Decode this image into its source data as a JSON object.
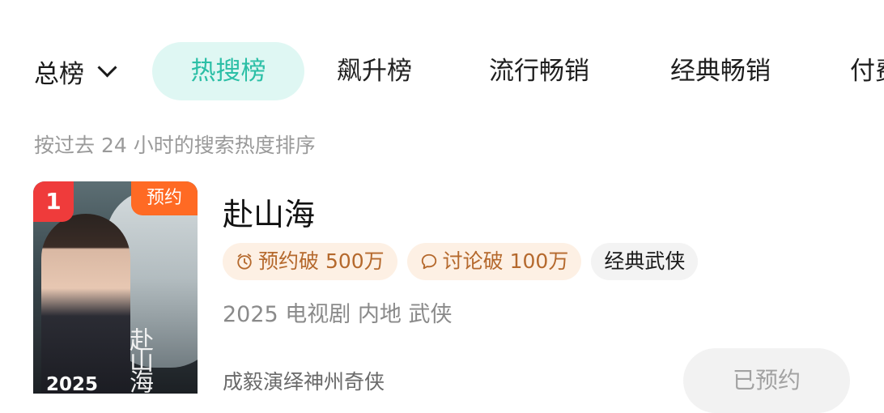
{
  "tabs": {
    "total_label": "总榜",
    "items": [
      {
        "label": "热搜榜"
      },
      {
        "label": "飙升榜"
      },
      {
        "label": "流行畅销"
      },
      {
        "label": "经典畅销"
      },
      {
        "label": "付费"
      }
    ],
    "active_color": "#2bbfa6",
    "active_bg": "#dff7f3"
  },
  "subtitle": "按过去 24 小时的搜索热度排序",
  "item": {
    "rank": "1",
    "badge": "预约",
    "poster_year": "2025",
    "poster_calligraphy": "赴山海",
    "title": "赴山海",
    "tags": [
      {
        "icon": "clock-icon",
        "text": "预约破 500万"
      },
      {
        "icon": "chat-bubble-icon",
        "text": "讨论破 100万"
      },
      {
        "text": "经典武侠"
      }
    ],
    "meta": "2025 电视剧 内地 武侠",
    "description": "成毅演绎神州奇侠",
    "reserve_button": "已预约"
  },
  "colors": {
    "rank_bg": "#ef3b3b",
    "badge_bg": "#ff6a24",
    "tag_warm_text": "#b5692d",
    "tag_warm_bg": "#fdf0e4"
  }
}
